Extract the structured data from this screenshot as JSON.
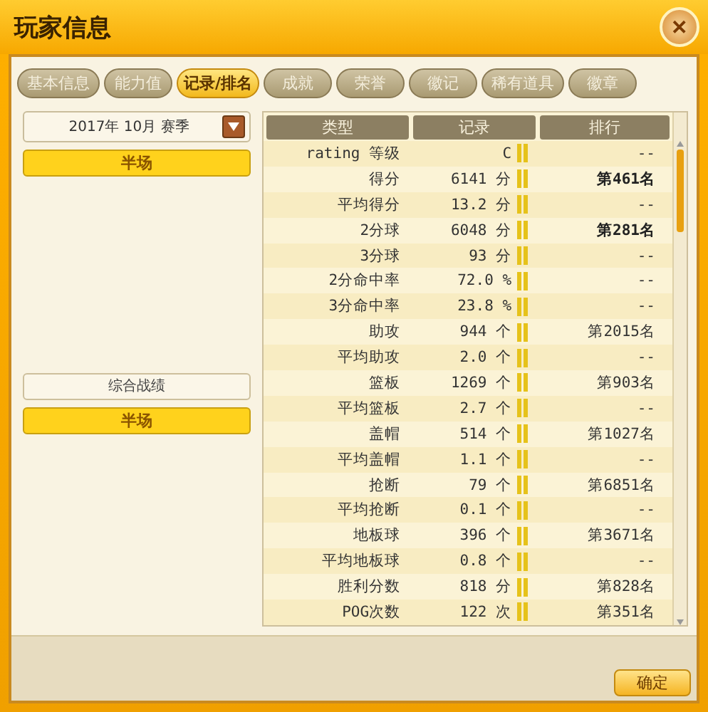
{
  "window": {
    "title": "玩家信息",
    "close": "✕"
  },
  "tabs": [
    {
      "label": "基本信息",
      "selected": false
    },
    {
      "label": "能力值",
      "selected": false
    },
    {
      "label": "记录/排名",
      "selected": true
    },
    {
      "label": "成就",
      "selected": false
    },
    {
      "label": "荣誉",
      "selected": false
    },
    {
      "label": "徽记",
      "selected": false
    },
    {
      "label": "稀有道具",
      "selected": false
    },
    {
      "label": "徽章",
      "selected": false
    }
  ],
  "left_panel": {
    "season": {
      "value": "2017年 10月 赛季"
    },
    "top_buttons": [
      {
        "label": "半场",
        "selected": true
      }
    ],
    "summary_label": "综合战绩",
    "bottom_buttons": [
      {
        "label": "半场",
        "selected": true
      }
    ]
  },
  "table": {
    "columns": [
      "类型",
      "记录",
      "排行"
    ],
    "rows": [
      {
        "type": "rating 等级",
        "record": "C",
        "rank": "--",
        "bold": false
      },
      {
        "type": "得分",
        "record": "6141 分",
        "rank": "第461名",
        "bold": true
      },
      {
        "type": "平均得分",
        "record": "13.2 分",
        "rank": "--",
        "bold": false
      },
      {
        "type": "2分球",
        "record": "6048 分",
        "rank": "第281名",
        "bold": true
      },
      {
        "type": "3分球",
        "record": "93 分",
        "rank": "--",
        "bold": false
      },
      {
        "type": "2分命中率",
        "record": "72.0 %",
        "rank": "--",
        "bold": false
      },
      {
        "type": "3分命中率",
        "record": "23.8 %",
        "rank": "--",
        "bold": false
      },
      {
        "type": "助攻",
        "record": "944 个",
        "rank": "第2015名",
        "bold": false
      },
      {
        "type": "平均助攻",
        "record": "2.0 个",
        "rank": "--",
        "bold": false
      },
      {
        "type": "篮板",
        "record": "1269 个",
        "rank": "第903名",
        "bold": false
      },
      {
        "type": "平均篮板",
        "record": "2.7 个",
        "rank": "--",
        "bold": false
      },
      {
        "type": "盖帽",
        "record": "514 个",
        "rank": "第1027名",
        "bold": false
      },
      {
        "type": "平均盖帽",
        "record": "1.1 个",
        "rank": "--",
        "bold": false
      },
      {
        "type": "抢断",
        "record": "79 个",
        "rank": "第6851名",
        "bold": false
      },
      {
        "type": "平均抢断",
        "record": "0.1 个",
        "rank": "--",
        "bold": false
      },
      {
        "type": "地板球",
        "record": "396 个",
        "rank": "第3671名",
        "bold": false
      },
      {
        "type": "平均地板球",
        "record": "0.8 个",
        "rank": "--",
        "bold": false
      },
      {
        "type": "胜利分数",
        "record": "818 分",
        "rank": "第828名",
        "bold": false
      },
      {
        "type": "POG次数",
        "record": "122 次",
        "rank": "第351名",
        "bold": false
      }
    ]
  },
  "confirm_button": "确定"
}
